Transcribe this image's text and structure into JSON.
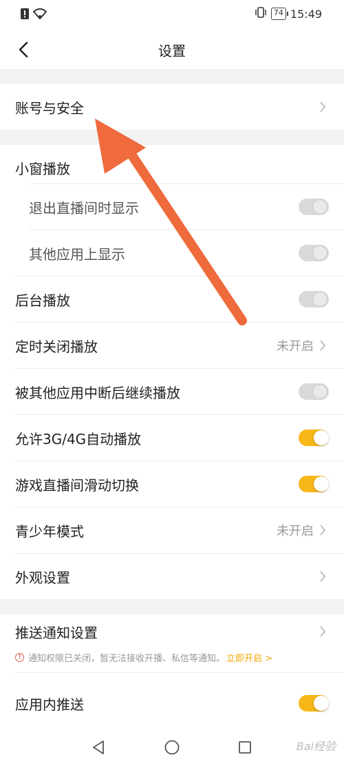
{
  "status_bar": {
    "time": "15:49",
    "battery": "74"
  },
  "header": {
    "title": "设置"
  },
  "account": {
    "label": "账号与安全"
  },
  "settings": {
    "mini_window": {
      "label": "小窗播放"
    },
    "exit_live_show": {
      "label": "退出直播间时显示",
      "on": false
    },
    "other_app_show": {
      "label": "其他应用上显示",
      "on": false
    },
    "background_play": {
      "label": "后台播放",
      "on": false
    },
    "timer_close": {
      "label": "定时关闭播放",
      "value": "未开启"
    },
    "resume_after_interrupt": {
      "label": "被其他应用中断后继续播放",
      "on": false
    },
    "mobile_autoplay": {
      "label": "允许3G/4G自动播放",
      "on": true
    },
    "swipe_switch": {
      "label": "游戏直播间滑动切换",
      "on": true
    },
    "teen_mode": {
      "label": "青少年模式",
      "value": "未开启"
    },
    "appearance": {
      "label": "外观设置"
    }
  },
  "push": {
    "label": "推送通知设置",
    "notice": "通知权限已关闭，暂无法接收开播、私信等通知。",
    "notice_link": "立即开启 >",
    "in_app": {
      "label": "应用内推送",
      "on": true
    }
  },
  "colors": {
    "accent": "#f7b718",
    "annotation_arrow": "#ef6a3c"
  },
  "watermark": "Bai经验"
}
